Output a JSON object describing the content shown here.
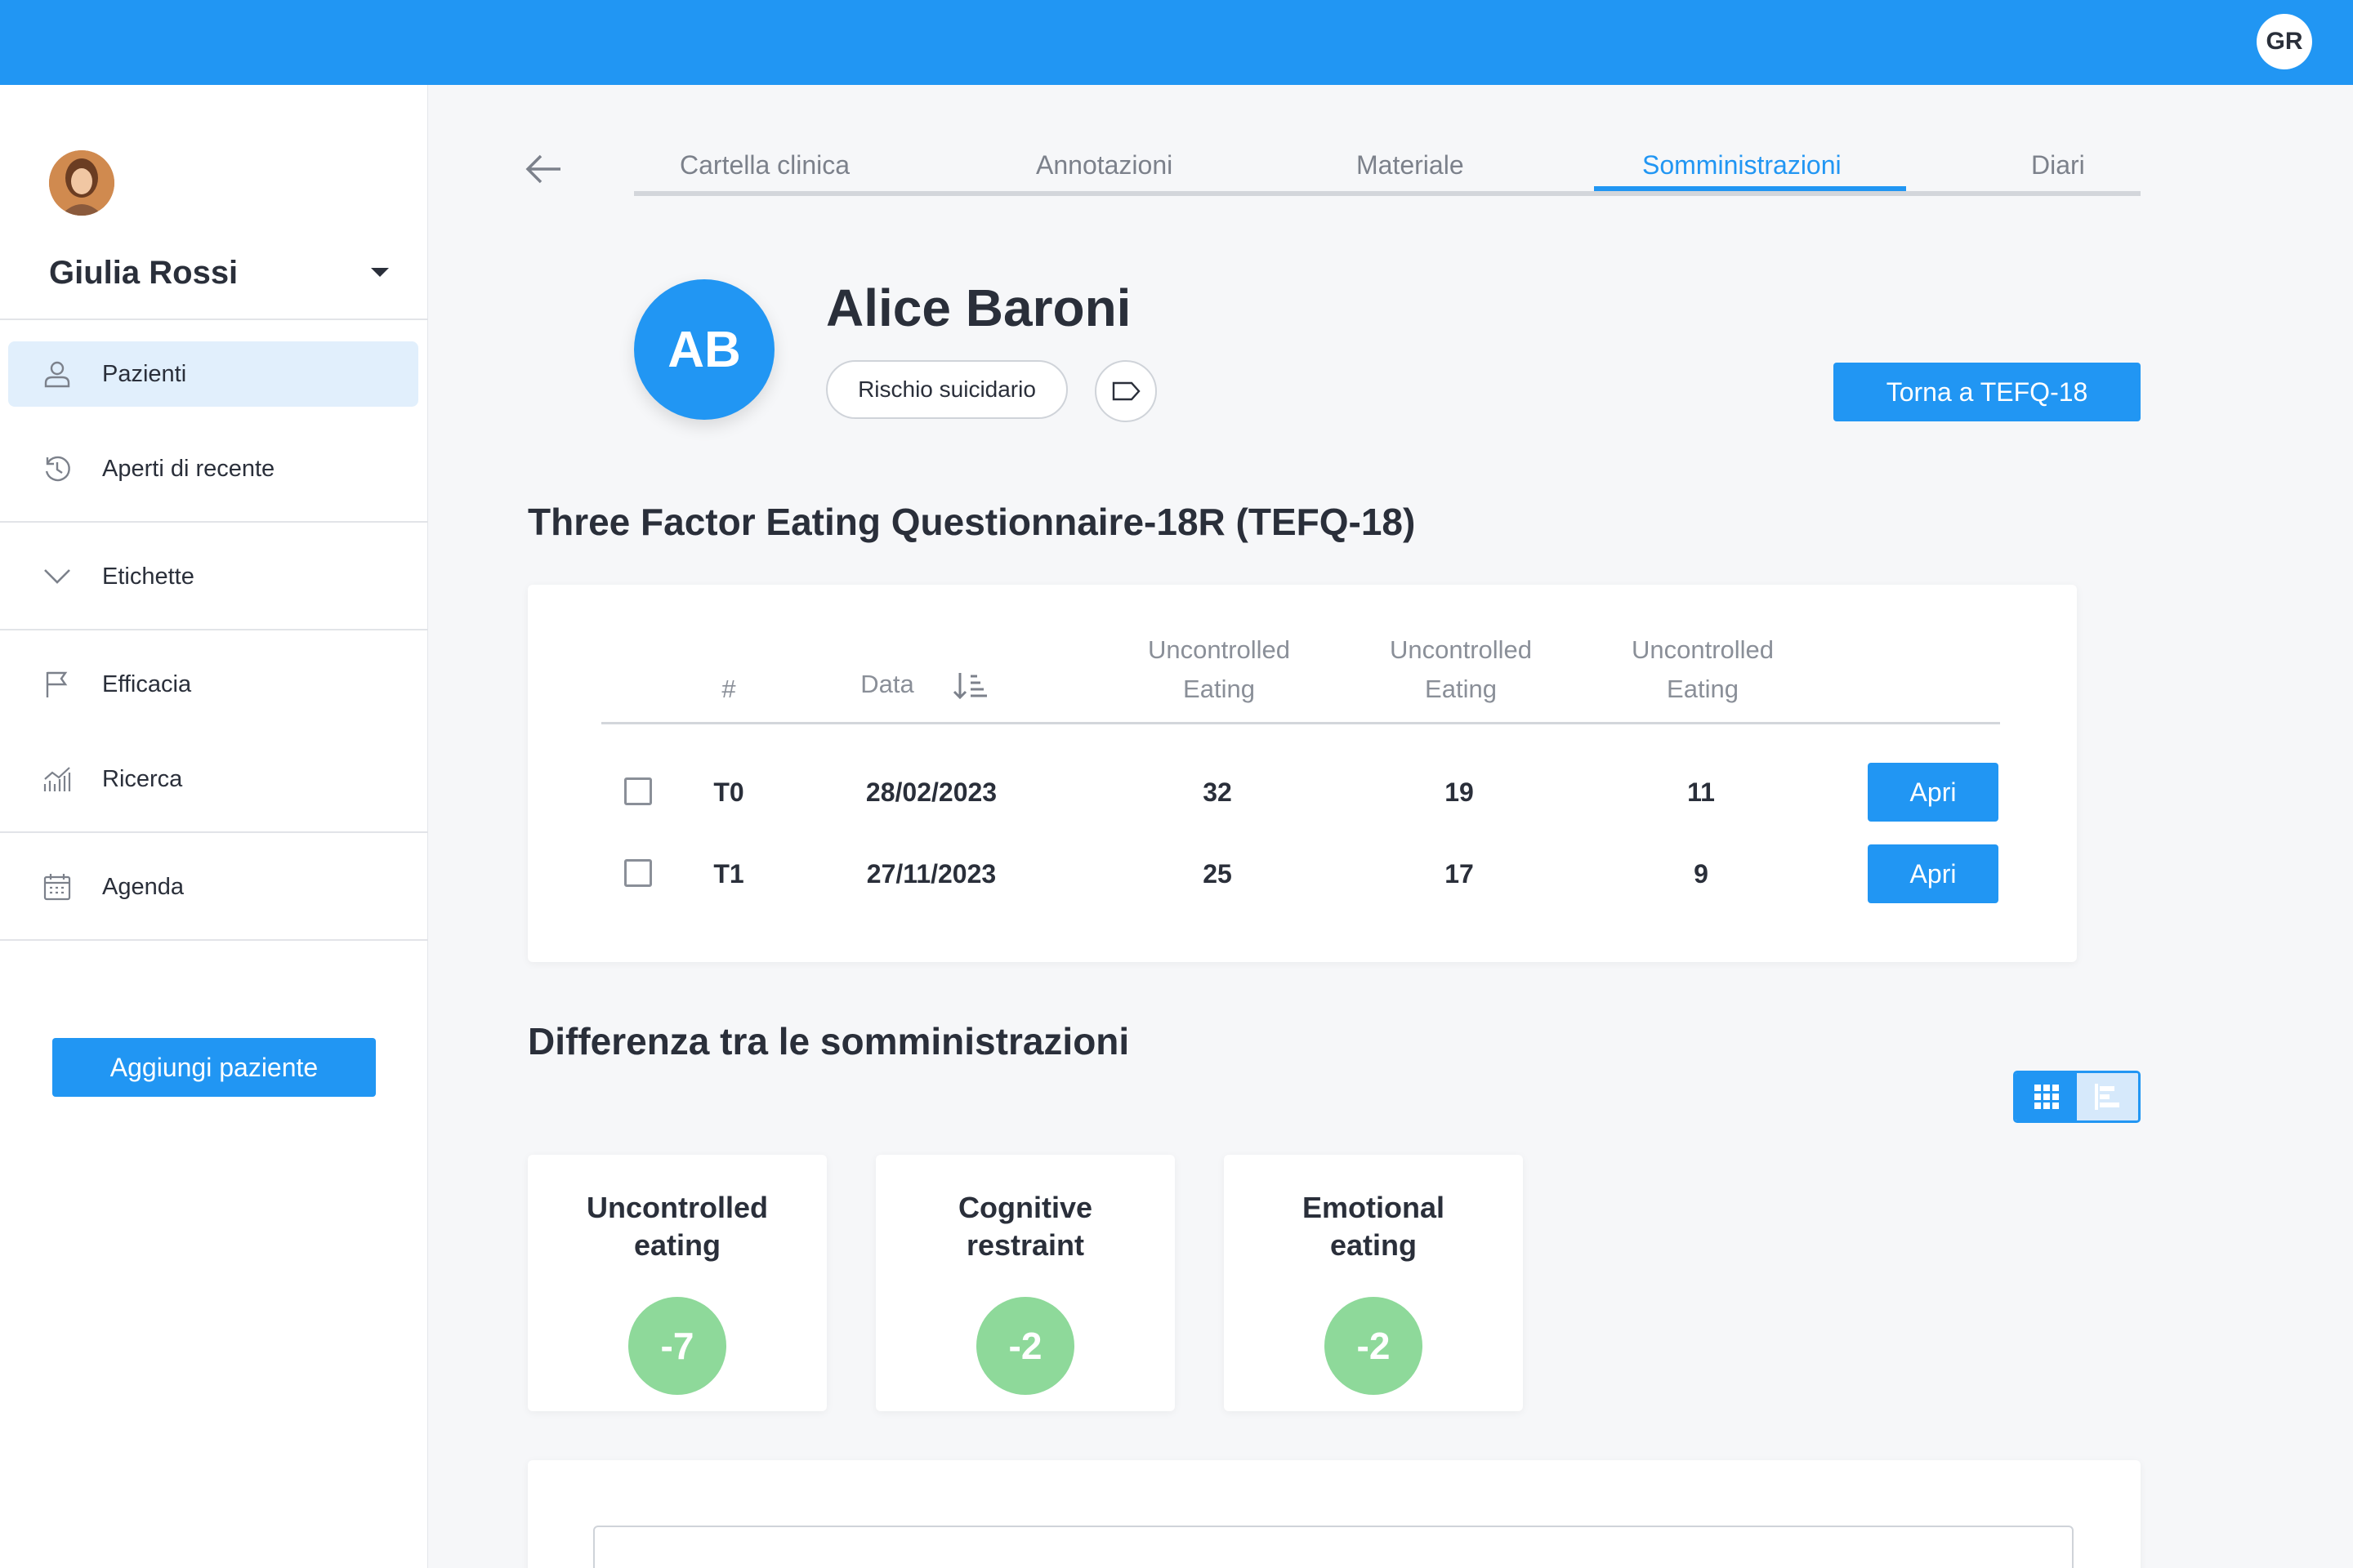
{
  "topbar": {
    "user_initials": "GR"
  },
  "sidebar": {
    "profile_name": "Giulia Rossi",
    "nav": [
      {
        "label": "Pazienti",
        "icon": "user-icon",
        "active": true
      },
      {
        "label": "Aperti di recente",
        "icon": "history-icon"
      },
      {
        "label": "Etichette",
        "icon": "chevron-down-icon"
      },
      {
        "label": "Efficacia",
        "icon": "flag-icon"
      },
      {
        "label": "Ricerca",
        "icon": "chart-icon"
      },
      {
        "label": "Agenda",
        "icon": "calendar-icon"
      }
    ],
    "add_patient_label": "Aggiungi paziente"
  },
  "tabs": [
    {
      "label": "Cartella clinica"
    },
    {
      "label": "Annotazioni"
    },
    {
      "label": "Materiale"
    },
    {
      "label": "Somministrazioni",
      "active": true
    },
    {
      "label": "Diari"
    }
  ],
  "patient": {
    "initials": "AB",
    "name": "Alice Baroni",
    "risk_chip": "Rischio suicidario",
    "back_button": "Torna a TEFQ-18"
  },
  "questionnaire": {
    "title": "Three Factor Eating Questionnaire-18R (TEFQ-18)",
    "headers": {
      "num": "#",
      "date": "Data",
      "col1_line1": "Uncontrolled",
      "col1_line2": "Eating",
      "col2_line1": "Uncontrolled",
      "col2_line2": "Eating",
      "col3_line1": "Uncontrolled",
      "col3_line2": "Eating"
    },
    "rows": [
      {
        "id": "T0",
        "date": "28/02/2023",
        "v1": "32",
        "v2": "19",
        "v3": "11",
        "action": "Apri"
      },
      {
        "id": "T1",
        "date": "27/11/2023",
        "v1": "25",
        "v2": "17",
        "v3": "9",
        "action": "Apri"
      }
    ]
  },
  "difference": {
    "title": "Differenza tra le somministrazioni",
    "cards": [
      {
        "label_line1": "Uncontrolled",
        "label_line2": "eating",
        "value": "-7"
      },
      {
        "label_line1": "Cognitive",
        "label_line2": "restraint",
        "value": "-2"
      },
      {
        "label_line1": "Emotional",
        "label_line2": "eating",
        "value": "-2"
      }
    ],
    "score_color": "#8ed99a"
  },
  "colors": {
    "primary": "#2196f3",
    "active_bg": "#e1effc"
  }
}
